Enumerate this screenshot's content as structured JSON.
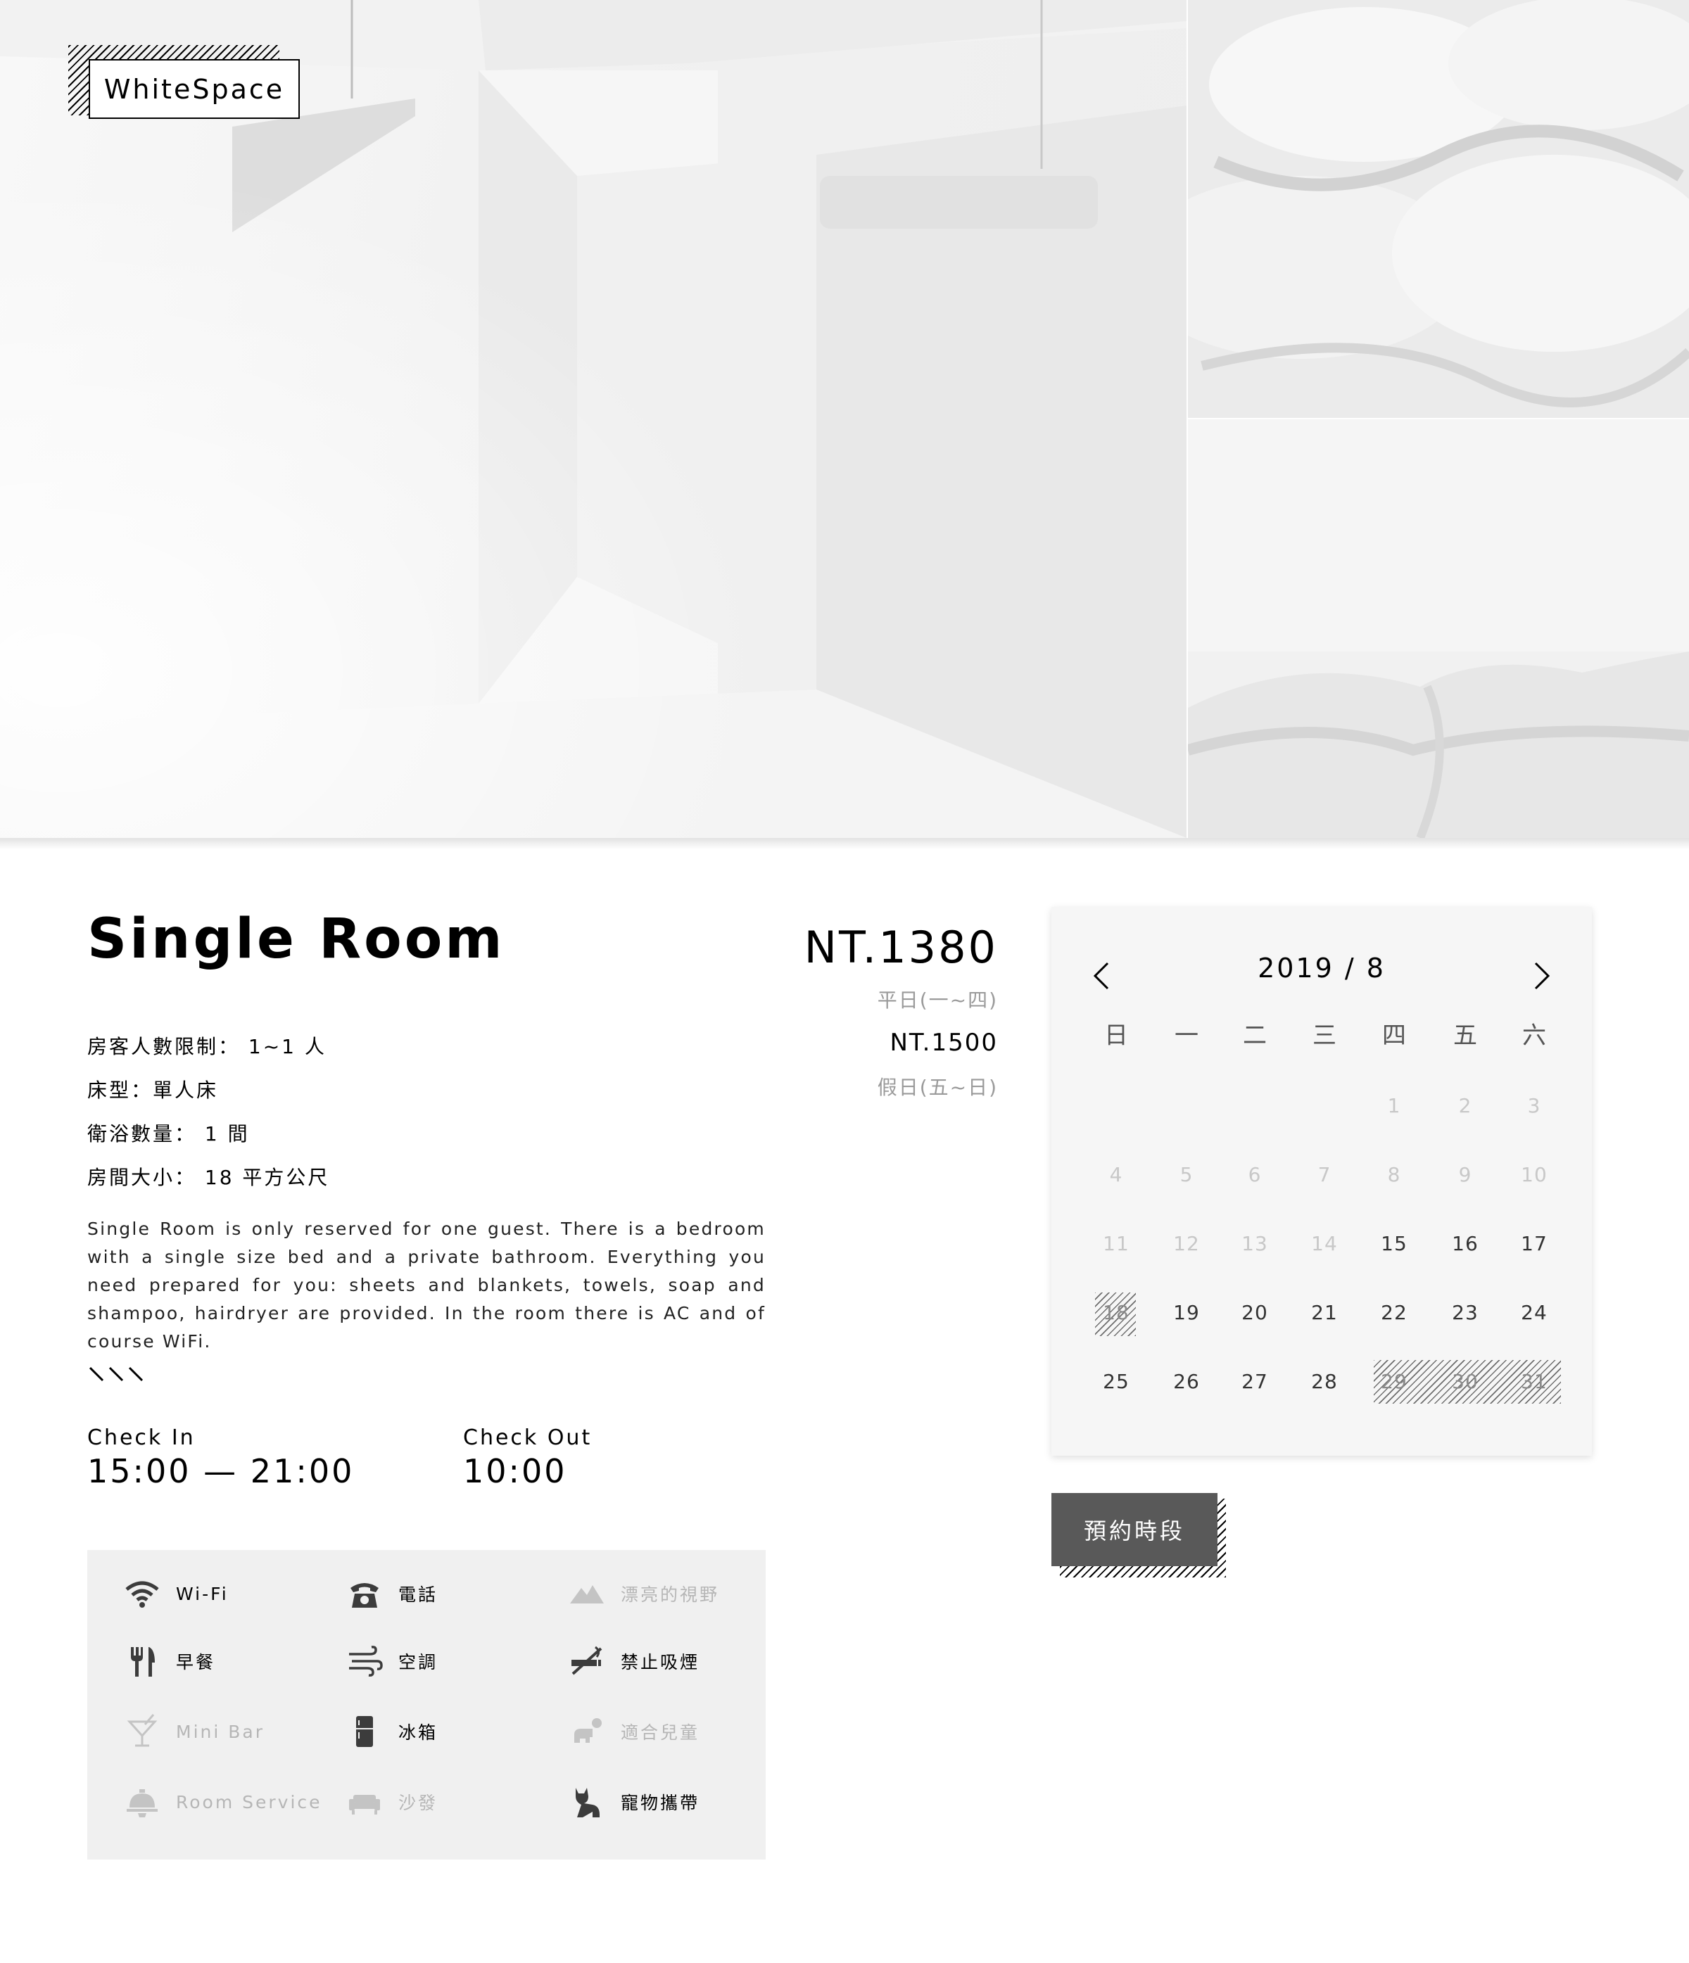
{
  "brand": {
    "logo_text": "WhiteSpace"
  },
  "room": {
    "title": "Single Room",
    "price_weekday": "NT.1380",
    "price_weekday_label": "平日(一~四)",
    "price_weekend": "NT.1500",
    "price_weekend_label": "假日(五~日)",
    "specs": [
      "房客人數限制： 1~1 人",
      "床型：單人床",
      "衛浴數量： 1 間",
      "房間大小： 18 平方公尺"
    ],
    "description": "Single Room is only reserved for one guest. There is a bedroom with a single size bed and a private bathroom. Everything you need prepared for you: sheets and blankets, towels, soap and shampoo, hairdryer are provided. In the room there is AC and of course WiFi.",
    "check_in_label": "Check In",
    "check_in_time": "15:00 — 21:00",
    "check_out_label": "Check Out",
    "check_out_time": "10:00"
  },
  "amenities": [
    {
      "icon": "wifi-icon",
      "label": "Wi-Fi",
      "available": true
    },
    {
      "icon": "telephone-icon",
      "label": "電話",
      "available": true
    },
    {
      "icon": "mountain-view-icon",
      "label": "漂亮的視野",
      "available": false
    },
    {
      "icon": "fork-knife-icon",
      "label": "早餐",
      "available": true
    },
    {
      "icon": "air-conditioner-icon",
      "label": "空調",
      "available": true
    },
    {
      "icon": "no-smoking-icon",
      "label": "禁止吸煙",
      "available": true
    },
    {
      "icon": "cocktail-icon",
      "label": "Mini Bar",
      "available": false
    },
    {
      "icon": "fridge-icon",
      "label": "冰箱",
      "available": true
    },
    {
      "icon": "kids-icon",
      "label": "適合兒童",
      "available": false
    },
    {
      "icon": "room-service-bell-icon",
      "label": "Room Service",
      "available": false
    },
    {
      "icon": "sofa-icon",
      "label": "沙發",
      "available": false
    },
    {
      "icon": "pet-icon",
      "label": "寵物攜帶",
      "available": true
    }
  ],
  "calendar": {
    "title": "2019 / 8",
    "weekdays": [
      "日",
      "一",
      "二",
      "三",
      "四",
      "五",
      "六"
    ],
    "weeks": [
      [
        null,
        null,
        null,
        null,
        1,
        2,
        3
      ],
      [
        4,
        5,
        6,
        7,
        8,
        9,
        10
      ],
      [
        11,
        12,
        13,
        14,
        15,
        16,
        17
      ],
      [
        18,
        19,
        20,
        21,
        22,
        23,
        24
      ],
      [
        25,
        26,
        27,
        28,
        29,
        30,
        31
      ]
    ],
    "past_days": [
      1,
      2,
      3,
      4,
      5,
      6,
      7,
      8,
      9,
      10,
      11,
      12,
      13,
      14
    ],
    "booked_days": [
      18,
      29,
      30,
      31
    ]
  },
  "actions": {
    "book_label": "預約時段"
  },
  "colors": {
    "accent": "#595959",
    "panel": "#f0f0f0",
    "calendar_bg": "#f6f6f6",
    "muted": "#9a9a9a"
  }
}
